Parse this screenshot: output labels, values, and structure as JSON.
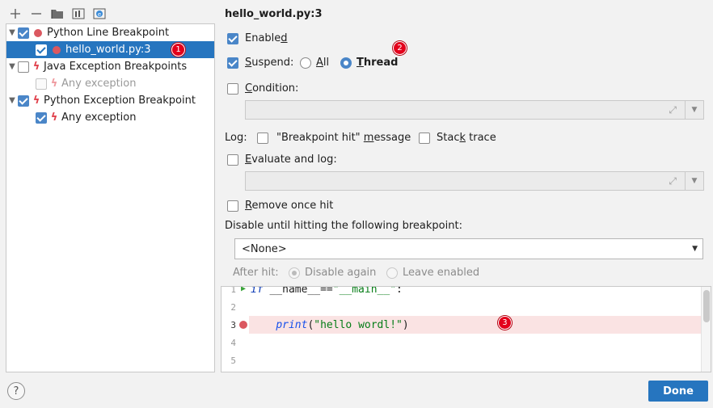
{
  "toolbar": {
    "icons": [
      "add-icon",
      "remove-icon",
      "folder-icon",
      "group-icon",
      "filter-icon"
    ]
  },
  "tree": {
    "items": [
      {
        "label": "Python Line Breakpoint",
        "checked": true,
        "expanded": true,
        "icon": "breakpoint-dot-icon"
      },
      {
        "label": "hello_world.py:3",
        "checked": true,
        "selected": true,
        "icon": "breakpoint-dot-icon"
      },
      {
        "label": "Java Exception Breakpoints",
        "checked": false,
        "expanded": true,
        "icon": "lightning-icon"
      },
      {
        "label": "Any exception",
        "checked": false,
        "disabled": true,
        "icon": "lightning-icon"
      },
      {
        "label": "Python Exception Breakpoint",
        "checked": true,
        "expanded": true,
        "icon": "lightning-icon"
      },
      {
        "label": "Any exception",
        "checked": true,
        "icon": "lightning-icon"
      }
    ]
  },
  "badges": [
    "1",
    "2",
    "3"
  ],
  "details": {
    "title": "hello_world.py:3",
    "enabled": {
      "pre": "Enable",
      "key": "d",
      "checked": true
    },
    "suspend": {
      "key": "S",
      "rest": "uspend:",
      "checked": true
    },
    "suspend_all": {
      "key": "A",
      "rest": "ll"
    },
    "suspend_thread": {
      "key": "T",
      "rest": "hread",
      "selected": true
    },
    "condition": {
      "key": "C",
      "rest": "ondition:",
      "checked": false
    },
    "log_label": "Log:",
    "log_message": {
      "pre": "\"Breakpoint hit\" ",
      "key": "m",
      "rest": "essage",
      "checked": false
    },
    "stack_trace": {
      "pre": "Stac",
      "key": "k",
      "rest": " trace",
      "checked": false
    },
    "evaluate": {
      "key": "E",
      "rest": "valuate and log:",
      "checked": false
    },
    "remove_once": {
      "key": "R",
      "rest": "emove once hit",
      "checked": false
    },
    "disable_until_label": "Disable until hitting the following breakpoint:",
    "disable_until_value": "<None>",
    "after_hit_label": "After hit:",
    "disable_again": "Disable again",
    "leave_enabled": "Leave enabled"
  },
  "editor": {
    "line_numbers": [
      "1",
      "2",
      "3",
      "4",
      "5"
    ],
    "line1": {
      "kw": "if",
      "a": " __name__==",
      "str": "\"__main__\"",
      "b": ":"
    },
    "line3": {
      "indent": "    ",
      "fn": "print",
      "a": "(",
      "str": "\"hello wordl!\"",
      "b": ")"
    },
    "breakpoint_line": 3
  },
  "footer": {
    "help": "?",
    "done": "Done"
  },
  "colors": {
    "accent": "#2675bf",
    "breakpoint": "#db5860",
    "badge": "#e3001b",
    "line_highlight": "#fae3e3"
  }
}
